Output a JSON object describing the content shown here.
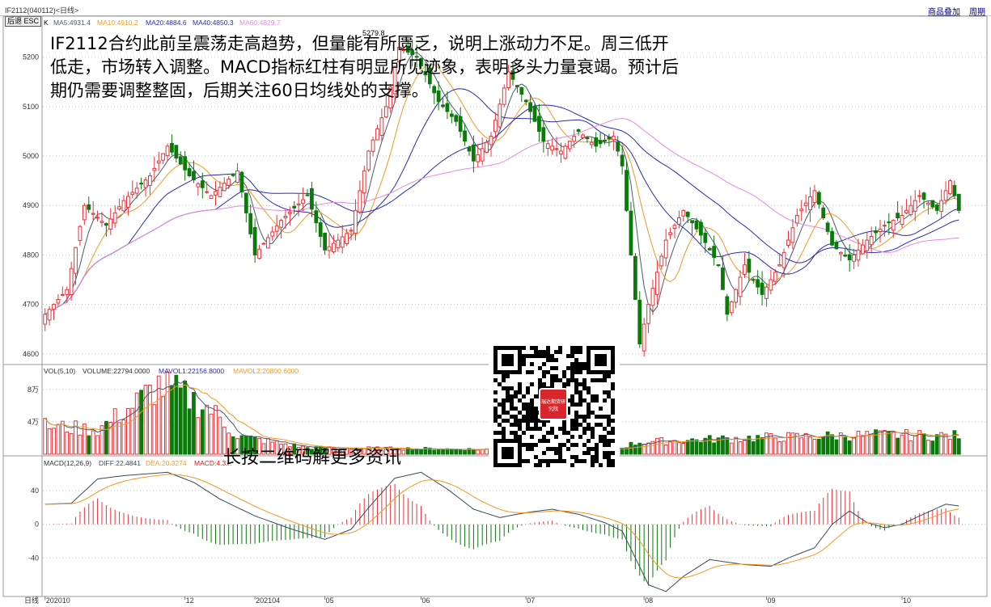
{
  "header": {
    "contract_title": "IF2112(040112)<日线>",
    "overlay_button": "商品叠加",
    "cycle_button": "周期",
    "back_button": "后退 ESC"
  },
  "price_panel": {
    "legend_prefix": "K",
    "ma5_label": "MA5:4931.4",
    "ma10_label": "MA10:4910.2",
    "ma20_label": "MA20:4884.6",
    "ma40_label": "MA40:4850.3",
    "ma60_label": "MA60:4829.7",
    "peak_label": "5279.8",
    "y_ticks": [
      "5200",
      "5100",
      "5000",
      "4900",
      "4800",
      "4700",
      "4600"
    ]
  },
  "volume_panel": {
    "legend_vol": "VOL(5,10)",
    "legend_volume": "VOLUME:22794.0000",
    "legend_mavol1": "MAVOL1:22156.8000",
    "legend_mavol2": "MAVOL2:20800.6000",
    "y_ticks": [
      "8万",
      "4万"
    ]
  },
  "macd_panel": {
    "legend_macd": "MACD(12,26,9)",
    "legend_diff": "DIFF:22.4841",
    "legend_dea": "DEA:20.3274",
    "legend_value": "MACD:4.3...",
    "y_ticks": [
      "40",
      "0",
      "-40"
    ]
  },
  "x_axis": {
    "period_label": "日线",
    "labels": [
      "202010",
      "12",
      "202104",
      "05",
      "06",
      "07",
      "08",
      "09",
      "10"
    ]
  },
  "annotation": {
    "text": "IF2112合约此前呈震荡走高趋势，但量能有所匮乏，说明上涨动力不足。周三低开低走，市场转入调整。MACD指标红柱有明显所见迹象，表明多头力量衰竭。预计后期仍需要调整整固，后期关注60日均线处的支撑。",
    "qr_caption": "长按二维码解更多资讯",
    "qr_logo_text": "瑞达期货研究院"
  },
  "colors": {
    "up": "#e8333a",
    "down": "#0a7a0a",
    "ma5": "#4a5a6a",
    "ma10": "#f39a1f",
    "ma20": "#2a2ab0",
    "ma40": "#2a2ab0",
    "ma60": "#e38ce3",
    "grid": "#bfbfbf",
    "axis_text": "#333333",
    "diff": "#3a4a5a",
    "dea": "#f39a1f"
  },
  "chart_data": [
    {
      "type": "candlestick",
      "name": "IF2112 daily K",
      "x_range": [
        "202010",
        "10"
      ],
      "ylim": [
        4580,
        5260
      ],
      "anchors": [
        [
          0,
          4680
        ],
        [
          5,
          4730
        ],
        [
          9,
          4900
        ],
        [
          14,
          4860
        ],
        [
          18,
          4910
        ],
        [
          24,
          4960
        ],
        [
          28,
          5020
        ],
        [
          33,
          4960
        ],
        [
          38,
          4920
        ],
        [
          44,
          4970
        ],
        [
          48,
          4800
        ],
        [
          54,
          4870
        ],
        [
          60,
          4920
        ],
        [
          64,
          4810
        ],
        [
          70,
          4850
        ],
        [
          74,
          5010
        ],
        [
          78,
          5100
        ],
        [
          81,
          5220
        ],
        [
          85,
          5200
        ],
        [
          90,
          5110
        ],
        [
          94,
          5070
        ],
        [
          98,
          4990
        ],
        [
          102,
          5040
        ],
        [
          106,
          5170
        ],
        [
          110,
          5110
        ],
        [
          114,
          5030
        ],
        [
          118,
          5010
        ],
        [
          122,
          5050
        ],
        [
          126,
          5020
        ],
        [
          130,
          5040
        ],
        [
          132,
          4980
        ],
        [
          136,
          4620
        ],
        [
          138,
          4700
        ],
        [
          142,
          4830
        ],
        [
          146,
          4890
        ],
        [
          150,
          4840
        ],
        [
          154,
          4780
        ],
        [
          156,
          4680
        ],
        [
          160,
          4780
        ],
        [
          164,
          4720
        ],
        [
          168,
          4780
        ],
        [
          172,
          4880
        ],
        [
          176,
          4930
        ],
        [
          180,
          4820
        ],
        [
          184,
          4790
        ],
        [
          188,
          4830
        ],
        [
          192,
          4860
        ],
        [
          196,
          4880
        ],
        [
          200,
          4920
        ],
        [
          204,
          4890
        ],
        [
          207,
          4950
        ],
        [
          209,
          4890
        ]
      ],
      "high": 5279.8,
      "low": 4580,
      "last_ma": {
        "MA5": 4931.4,
        "MA10": 4910.2,
        "MA20": 4884.6,
        "MA40": 4850.3,
        "MA60": 4829.7
      }
    },
    {
      "type": "bar",
      "name": "VOLUME",
      "ylim": [
        0,
        100000
      ],
      "anchors": [
        [
          0,
          35000
        ],
        [
          12,
          30000
        ],
        [
          20,
          60000
        ],
        [
          26,
          85000
        ],
        [
          32,
          72000
        ],
        [
          38,
          55000
        ],
        [
          44,
          22000
        ],
        [
          60,
          8000
        ],
        [
          100,
          6000
        ],
        [
          130,
          6000
        ],
        [
          136,
          15000
        ],
        [
          160,
          20000
        ],
        [
          190,
          24000
        ],
        [
          209,
          22794
        ]
      ]
    },
    {
      "type": "line",
      "name": "MACD",
      "ylim": [
        -85,
        70
      ],
      "anchors": [
        [
          0,
          24
        ],
        [
          6,
          25
        ],
        [
          12,
          54
        ],
        [
          18,
          58
        ],
        [
          28,
          62
        ],
        [
          34,
          50
        ],
        [
          40,
          30
        ],
        [
          48,
          10
        ],
        [
          56,
          -5
        ],
        [
          64,
          -18
        ],
        [
          70,
          -6
        ],
        [
          74,
          20
        ],
        [
          80,
          55
        ],
        [
          86,
          62
        ],
        [
          92,
          42
        ],
        [
          98,
          18
        ],
        [
          104,
          8
        ],
        [
          110,
          14
        ],
        [
          116,
          18
        ],
        [
          122,
          12
        ],
        [
          128,
          2
        ],
        [
          132,
          -8
        ],
        [
          138,
          -72
        ],
        [
          142,
          -80
        ],
        [
          146,
          -62
        ],
        [
          152,
          -42
        ],
        [
          160,
          -48
        ],
        [
          166,
          -50
        ],
        [
          170,
          -40
        ],
        [
          176,
          -28
        ],
        [
          180,
          0
        ],
        [
          184,
          16
        ],
        [
          188,
          2
        ],
        [
          192,
          -4
        ],
        [
          196,
          0
        ],
        [
          200,
          10
        ],
        [
          206,
          24
        ],
        [
          209,
          22
        ]
      ]
    }
  ]
}
